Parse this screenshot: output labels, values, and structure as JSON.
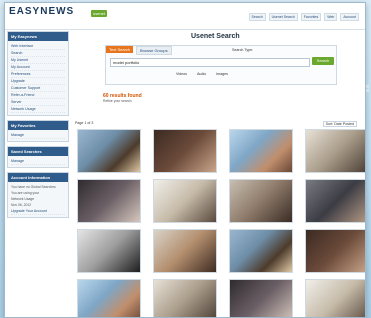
{
  "header": {
    "logo": "EASYNEWS",
    "logo_badge": "usenet",
    "nav": [
      "Search",
      "Usenet Search",
      "Favorites",
      "Web",
      "Account"
    ]
  },
  "sidebar": {
    "panels": [
      {
        "title": "My Easynews",
        "items": [
          "Web Interface",
          "Search",
          "My Usenet",
          "My Account",
          "Preferences",
          "Upgrade",
          "Customer Support",
          "Refer-a-Friend",
          "Server",
          "Network Usage"
        ]
      },
      {
        "title": "My Favorites",
        "items": [
          "Manage"
        ]
      },
      {
        "title": "Saved Searches",
        "items": [
          "Manage"
        ]
      },
      {
        "title": "Account Information",
        "notes": [
          "You have no Global Searches",
          "You are using your",
          "Network Usage",
          "Nov 06, 2012"
        ],
        "items": [
          "Upgrade Your Account"
        ]
      }
    ]
  },
  "main": {
    "title": "Usenet Search",
    "tabs": [
      "Text Search",
      "Browse Groups"
    ],
    "search_type_label": "Search Type:",
    "query_value": "model portfolio",
    "search_button": "Search",
    "filters": [
      "Videos",
      "Audio",
      "Images"
    ],
    "results_count": "60 results found",
    "results_note": "Refine your search",
    "pager": "Page 1 of 3",
    "sort_label": "Sort: Date Posted",
    "thumbnails_count": 12
  }
}
